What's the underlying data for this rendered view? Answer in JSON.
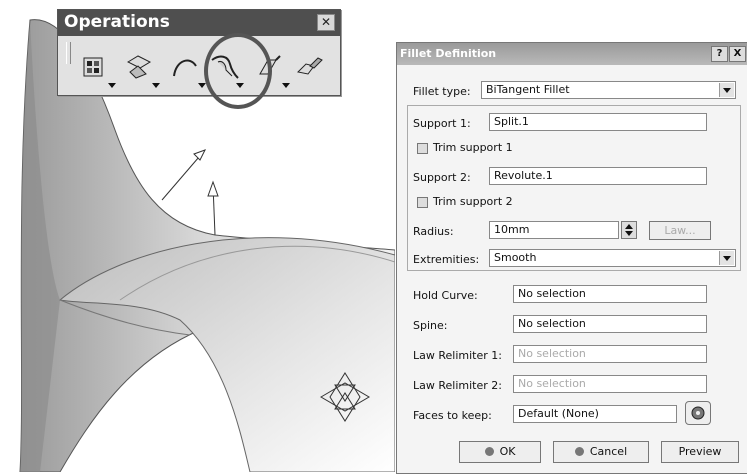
{
  "toolbar": {
    "title": "Operations",
    "close_glyph": "✕",
    "tools": [
      {
        "icon": "join-icon"
      },
      {
        "icon": "split-icon"
      },
      {
        "icon": "curve-fillet-icon"
      },
      {
        "icon": "shape-fillet-icon"
      },
      {
        "icon": "extrapolate-icon"
      },
      {
        "icon": "transform-icon"
      }
    ],
    "highlighted_tool": "shape-fillet-icon"
  },
  "dialog": {
    "title": "Fillet Definition",
    "help_glyph": "?",
    "close_glyph": "X",
    "fillet_type_label": "Fillet type:",
    "fillet_type_value": "BiTangent Fillet",
    "support1_label": "Support 1:",
    "support1_value": "Split.1",
    "trim1_label": "Trim support 1",
    "support2_label": "Support 2:",
    "support2_value": "Revolute.1",
    "trim2_label": "Trim support 2",
    "radius_label": "Radius:",
    "radius_value": "10mm",
    "law_button": "Law...",
    "extremities_label": "Extremities:",
    "extremities_value": "Smooth",
    "hold_curve_label": "Hold Curve:",
    "hold_curve_value": "No selection",
    "spine_label": "Spine:",
    "spine_value": "No selection",
    "law_relimiter1_label": "Law Relimiter 1:",
    "law_relimiter1_value": "No selection",
    "law_relimiter2_label": "Law Relimiter 2:",
    "law_relimiter2_value": "No selection",
    "faces_label": "Faces to keep:",
    "faces_value": "Default (None)",
    "ok_label": "OK",
    "cancel_label": "Cancel",
    "preview_label": "Preview"
  },
  "colors": {
    "toolbar_title_bg": "#4f4f4f",
    "dialog_title_bg": "#a8a8a8",
    "surface": "#cfcfcf"
  }
}
